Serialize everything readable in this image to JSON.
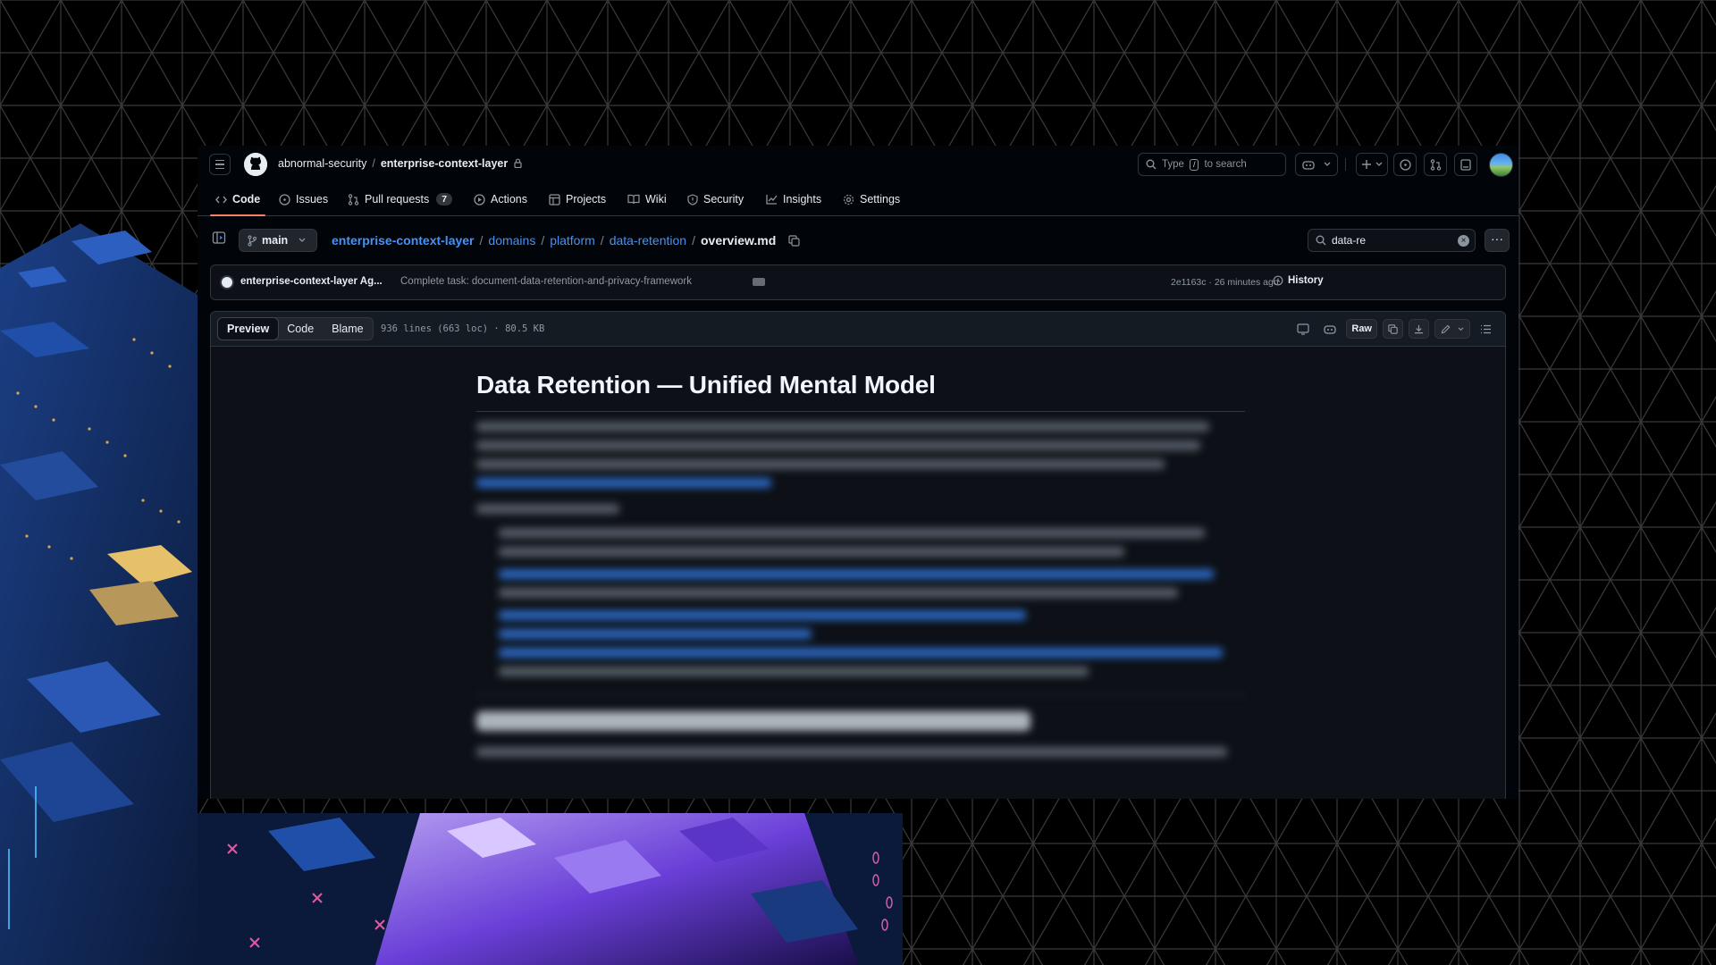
{
  "header": {
    "owner": "abnormal-security",
    "separator": "/",
    "repo": "enterprise-context-layer",
    "search_label": "Type",
    "search_key": "/",
    "search_suffix": "to search"
  },
  "repo_nav": {
    "tabs": [
      {
        "label": "Code",
        "icon": "code-icon",
        "selected": true
      },
      {
        "label": "Issues",
        "icon": "issue-opened-icon"
      },
      {
        "label": "Pull requests",
        "icon": "git-pull-request-icon",
        "count": "7"
      },
      {
        "label": "Actions",
        "icon": "play-icon"
      },
      {
        "label": "Projects",
        "icon": "table-icon"
      },
      {
        "label": "Wiki",
        "icon": "book-icon"
      },
      {
        "label": "Security",
        "icon": "shield-icon"
      },
      {
        "label": "Insights",
        "icon": "graph-icon"
      },
      {
        "label": "Settings",
        "icon": "gear-icon"
      }
    ]
  },
  "file_bar": {
    "branch": "main",
    "path": [
      "enterprise-context-layer",
      "domains",
      "platform",
      "data-retention"
    ],
    "file": "overview.md",
    "search_value": "data-re"
  },
  "commit": {
    "author": "enterprise-context-layer Ag...",
    "message": "Complete task: document-data-retention-and-privacy-framework",
    "meta": "2e1163c · 26 minutes ago",
    "history_label": "History"
  },
  "file": {
    "modes": [
      "Preview",
      "Code",
      "Blame"
    ],
    "active_mode": "Preview",
    "stats": "936 lines (663 loc) · 80.5 KB",
    "raw_label": "Raw"
  },
  "markdown": {
    "title": "Data Retention — Unified Mental Model"
  }
}
